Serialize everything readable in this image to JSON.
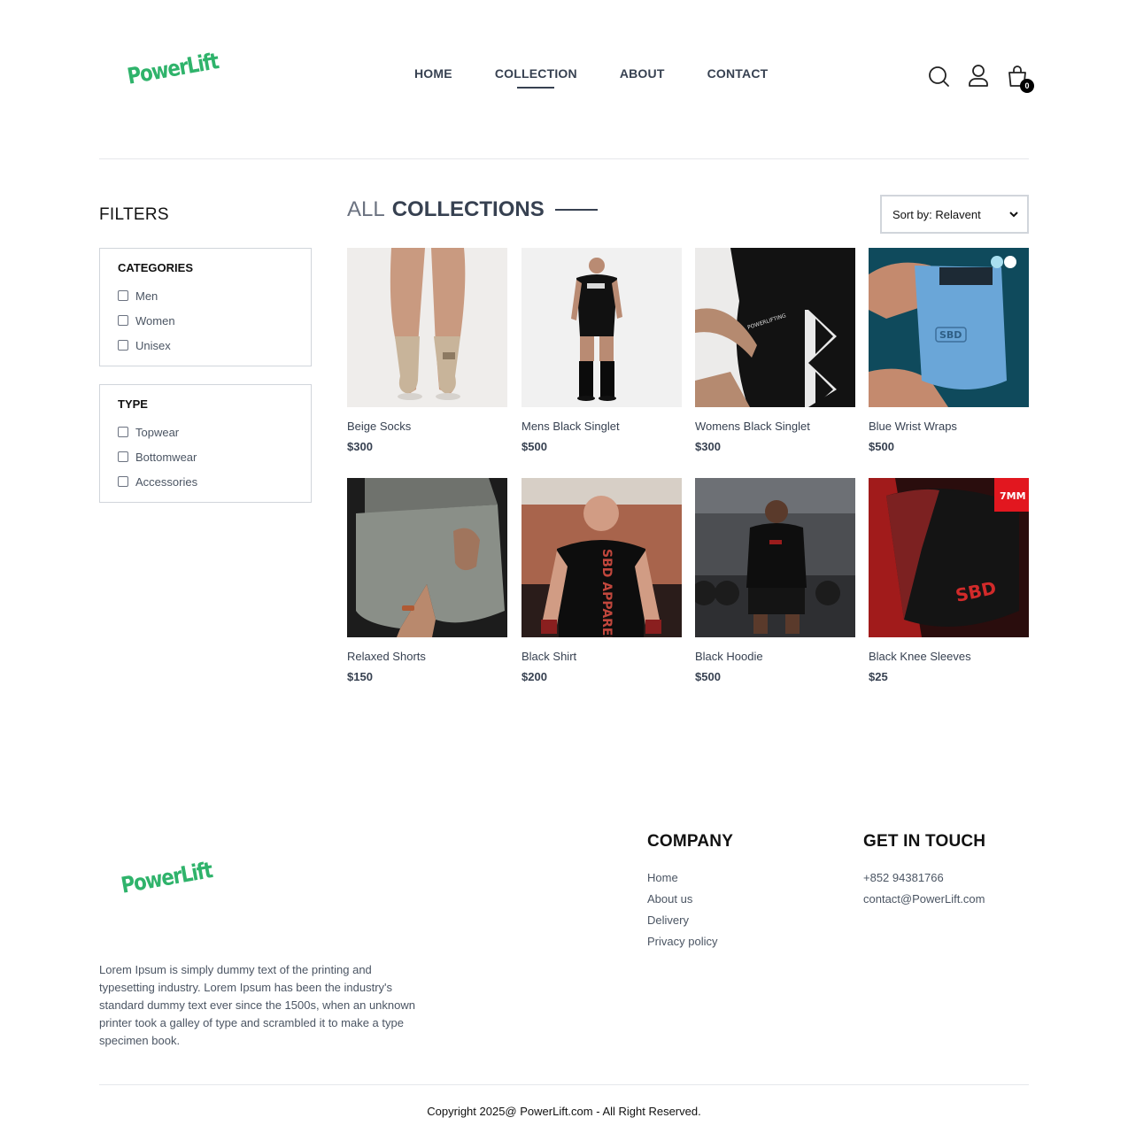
{
  "brand": {
    "logo_text": "PowerLift",
    "accent_color": "#2fb36b"
  },
  "nav": {
    "items": [
      {
        "label": "HOME",
        "active": false
      },
      {
        "label": "COLLECTION",
        "active": true
      },
      {
        "label": "ABOUT",
        "active": false
      },
      {
        "label": "CONTACT",
        "active": false
      }
    ]
  },
  "header_icons": {
    "search": "search-icon",
    "profile": "user-icon",
    "cart": "cart-icon",
    "cart_count": "0"
  },
  "filters": {
    "title": "FILTERS",
    "categories": {
      "heading": "CATEGORIES",
      "options": [
        "Men",
        "Women",
        "Unisex"
      ]
    },
    "type": {
      "heading": "TYPE",
      "options": [
        "Topwear",
        "Bottomwear",
        "Accessories"
      ]
    }
  },
  "collection": {
    "title_light": "ALL",
    "title_bold": "COLLECTIONS",
    "sort_label": "Sort by: Relavent"
  },
  "products": [
    {
      "name": "Beige Socks",
      "price": "$300"
    },
    {
      "name": "Mens Black Singlet",
      "price": "$500"
    },
    {
      "name": "Womens Black Singlet",
      "price": "$300"
    },
    {
      "name": "Blue Wrist Wraps",
      "price": "$500"
    },
    {
      "name": "Relaxed Shorts",
      "price": "$150"
    },
    {
      "name": "Black Shirt",
      "price": "$200"
    },
    {
      "name": "Black Hoodie",
      "price": "$500"
    },
    {
      "name": "Black Knee Sleeves",
      "price": "$25"
    }
  ],
  "footer": {
    "description": "Lorem Ipsum is simply dummy text of the printing and typesetting industry. Lorem Ipsum has been the industry's standard dummy text ever since the 1500s, when an unknown printer took a galley of type and scrambled it to make a type specimen book.",
    "company": {
      "heading": "COMPANY",
      "links": [
        "Home",
        "About us",
        "Delivery",
        "Privacy policy"
      ]
    },
    "contact": {
      "heading": "GET IN TOUCH",
      "phone": "+852 94381766",
      "email": "contact@PowerLift.com"
    },
    "copyright": "Copyright 2025@ PowerLift.com - All Right Reserved."
  }
}
